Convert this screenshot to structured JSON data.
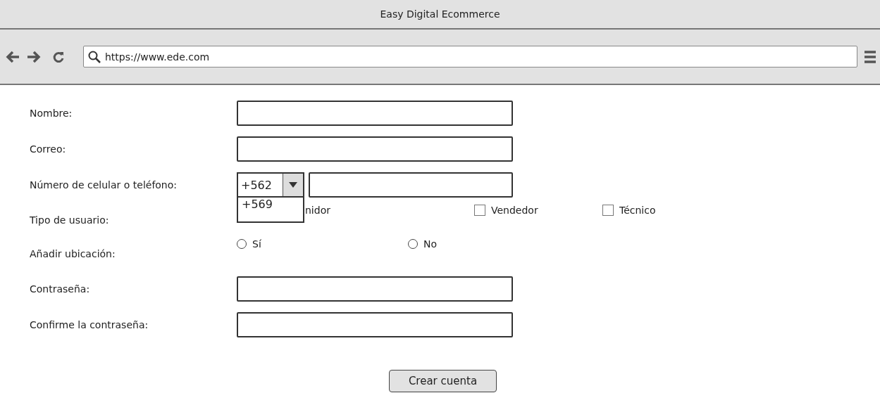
{
  "window": {
    "title": "Easy Digital Ecommerce"
  },
  "address_bar": {
    "url": "https://www.ede.com"
  },
  "form": {
    "name": {
      "label": "Nombre:"
    },
    "email": {
      "label": "Correo:"
    },
    "phone": {
      "label": "Número de celular o teléfono:",
      "prefix": "+562",
      "dropdown_open": true,
      "options": [
        "+569"
      ]
    },
    "user_type": {
      "label": "Tipo de usuario:",
      "options": [
        {
          "kind": "covered",
          "label": "nidor"
        },
        {
          "kind": "checkbox",
          "label": "Vendedor",
          "checked": false
        },
        {
          "kind": "checkbox",
          "label": "Técnico",
          "checked": false
        }
      ]
    },
    "location": {
      "label": "Añadir ubicación:",
      "options": [
        {
          "label": "Sí",
          "selected": false
        },
        {
          "label": "No",
          "selected": false
        }
      ]
    },
    "password": {
      "label": "Contraseña:"
    },
    "confirm_password": {
      "label": "Confirme la contraseña:"
    },
    "submit": "Crear cuenta"
  }
}
